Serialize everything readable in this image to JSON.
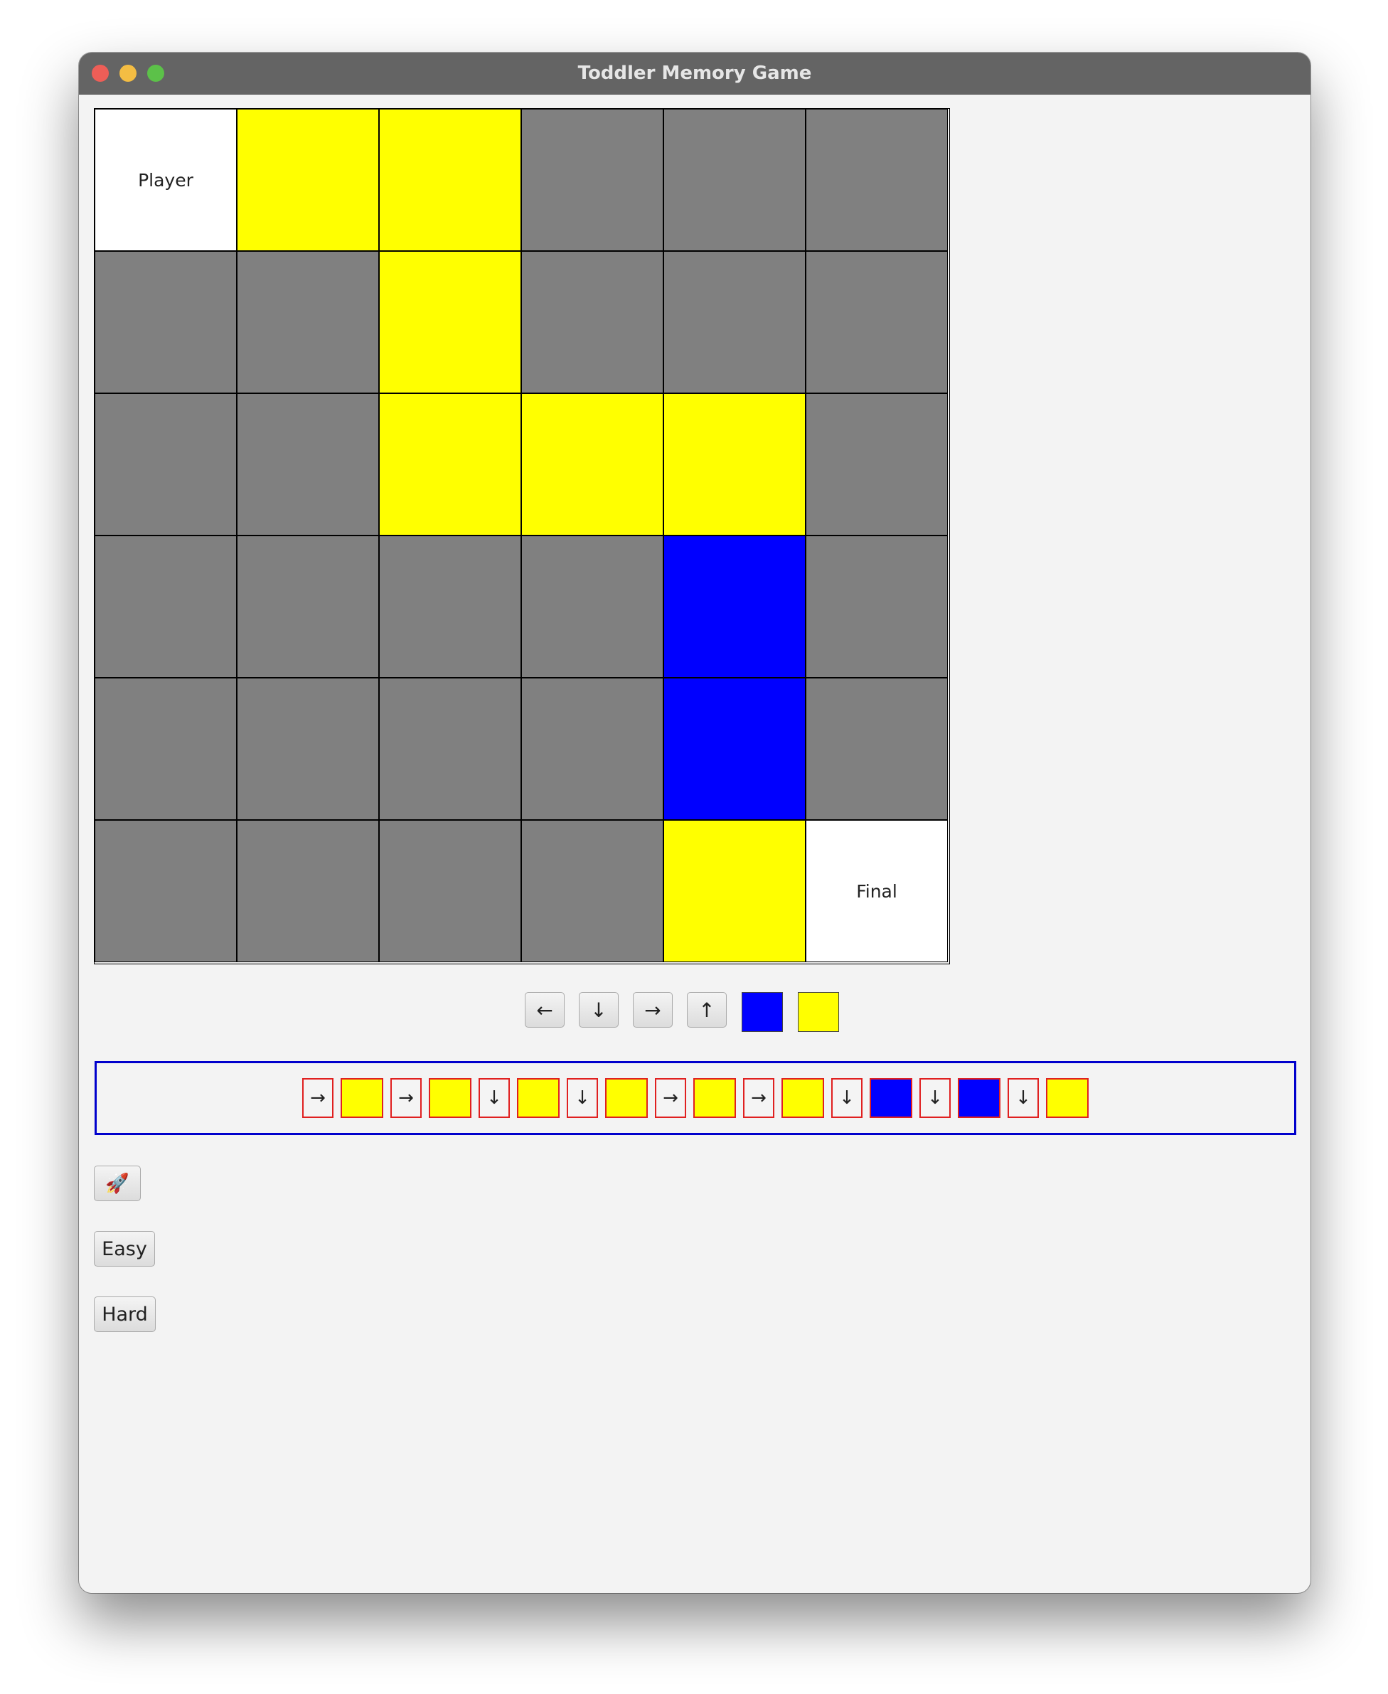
{
  "window": {
    "title": "Toddler Memory Game"
  },
  "board": {
    "rows": [
      [
        {
          "color": "white",
          "label": "Player"
        },
        {
          "color": "yellow",
          "label": ""
        },
        {
          "color": "yellow",
          "label": ""
        },
        {
          "color": "gray",
          "label": ""
        },
        {
          "color": "gray",
          "label": ""
        },
        {
          "color": "gray",
          "label": ""
        }
      ],
      [
        {
          "color": "gray",
          "label": ""
        },
        {
          "color": "gray",
          "label": ""
        },
        {
          "color": "yellow",
          "label": ""
        },
        {
          "color": "gray",
          "label": ""
        },
        {
          "color": "gray",
          "label": ""
        },
        {
          "color": "gray",
          "label": ""
        }
      ],
      [
        {
          "color": "gray",
          "label": ""
        },
        {
          "color": "gray",
          "label": ""
        },
        {
          "color": "yellow",
          "label": ""
        },
        {
          "color": "yellow",
          "label": ""
        },
        {
          "color": "yellow",
          "label": ""
        },
        {
          "color": "gray",
          "label": ""
        }
      ],
      [
        {
          "color": "gray",
          "label": ""
        },
        {
          "color": "gray",
          "label": ""
        },
        {
          "color": "gray",
          "label": ""
        },
        {
          "color": "gray",
          "label": ""
        },
        {
          "color": "blue",
          "label": ""
        },
        {
          "color": "gray",
          "label": ""
        }
      ],
      [
        {
          "color": "gray",
          "label": ""
        },
        {
          "color": "gray",
          "label": ""
        },
        {
          "color": "gray",
          "label": ""
        },
        {
          "color": "gray",
          "label": ""
        },
        {
          "color": "blue",
          "label": ""
        },
        {
          "color": "gray",
          "label": ""
        }
      ],
      [
        {
          "color": "gray",
          "label": ""
        },
        {
          "color": "gray",
          "label": ""
        },
        {
          "color": "gray",
          "label": ""
        },
        {
          "color": "gray",
          "label": ""
        },
        {
          "color": "yellow",
          "label": ""
        },
        {
          "color": "white",
          "label": "Final"
        }
      ]
    ],
    "colors": {
      "white": "#ffffff",
      "gray": "#808080",
      "yellow": "#ffff00",
      "blue": "#0000ff"
    }
  },
  "controls": {
    "left_label": "←",
    "down_label": "↓",
    "right_label": "→",
    "up_label": "↑",
    "blue_swatch": "#0000ff",
    "yellow_swatch": "#ffff00"
  },
  "sequence": [
    {
      "type": "arrow",
      "label": "→"
    },
    {
      "type": "color",
      "color": "#ffff00"
    },
    {
      "type": "arrow",
      "label": "→"
    },
    {
      "type": "color",
      "color": "#ffff00"
    },
    {
      "type": "arrow",
      "label": "↓"
    },
    {
      "type": "color",
      "color": "#ffff00"
    },
    {
      "type": "arrow",
      "label": "↓"
    },
    {
      "type": "color",
      "color": "#ffff00"
    },
    {
      "type": "arrow",
      "label": "→"
    },
    {
      "type": "color",
      "color": "#ffff00"
    },
    {
      "type": "arrow",
      "label": "→"
    },
    {
      "type": "color",
      "color": "#ffff00"
    },
    {
      "type": "arrow",
      "label": "↓"
    },
    {
      "type": "color",
      "color": "#0000ff"
    },
    {
      "type": "arrow",
      "label": "↓"
    },
    {
      "type": "color",
      "color": "#0000ff"
    },
    {
      "type": "arrow",
      "label": "↓"
    },
    {
      "type": "color",
      "color": "#ffff00"
    }
  ],
  "buttons": {
    "rocket_label": "🚀",
    "easy_label": "Easy",
    "hard_label": "Hard"
  }
}
